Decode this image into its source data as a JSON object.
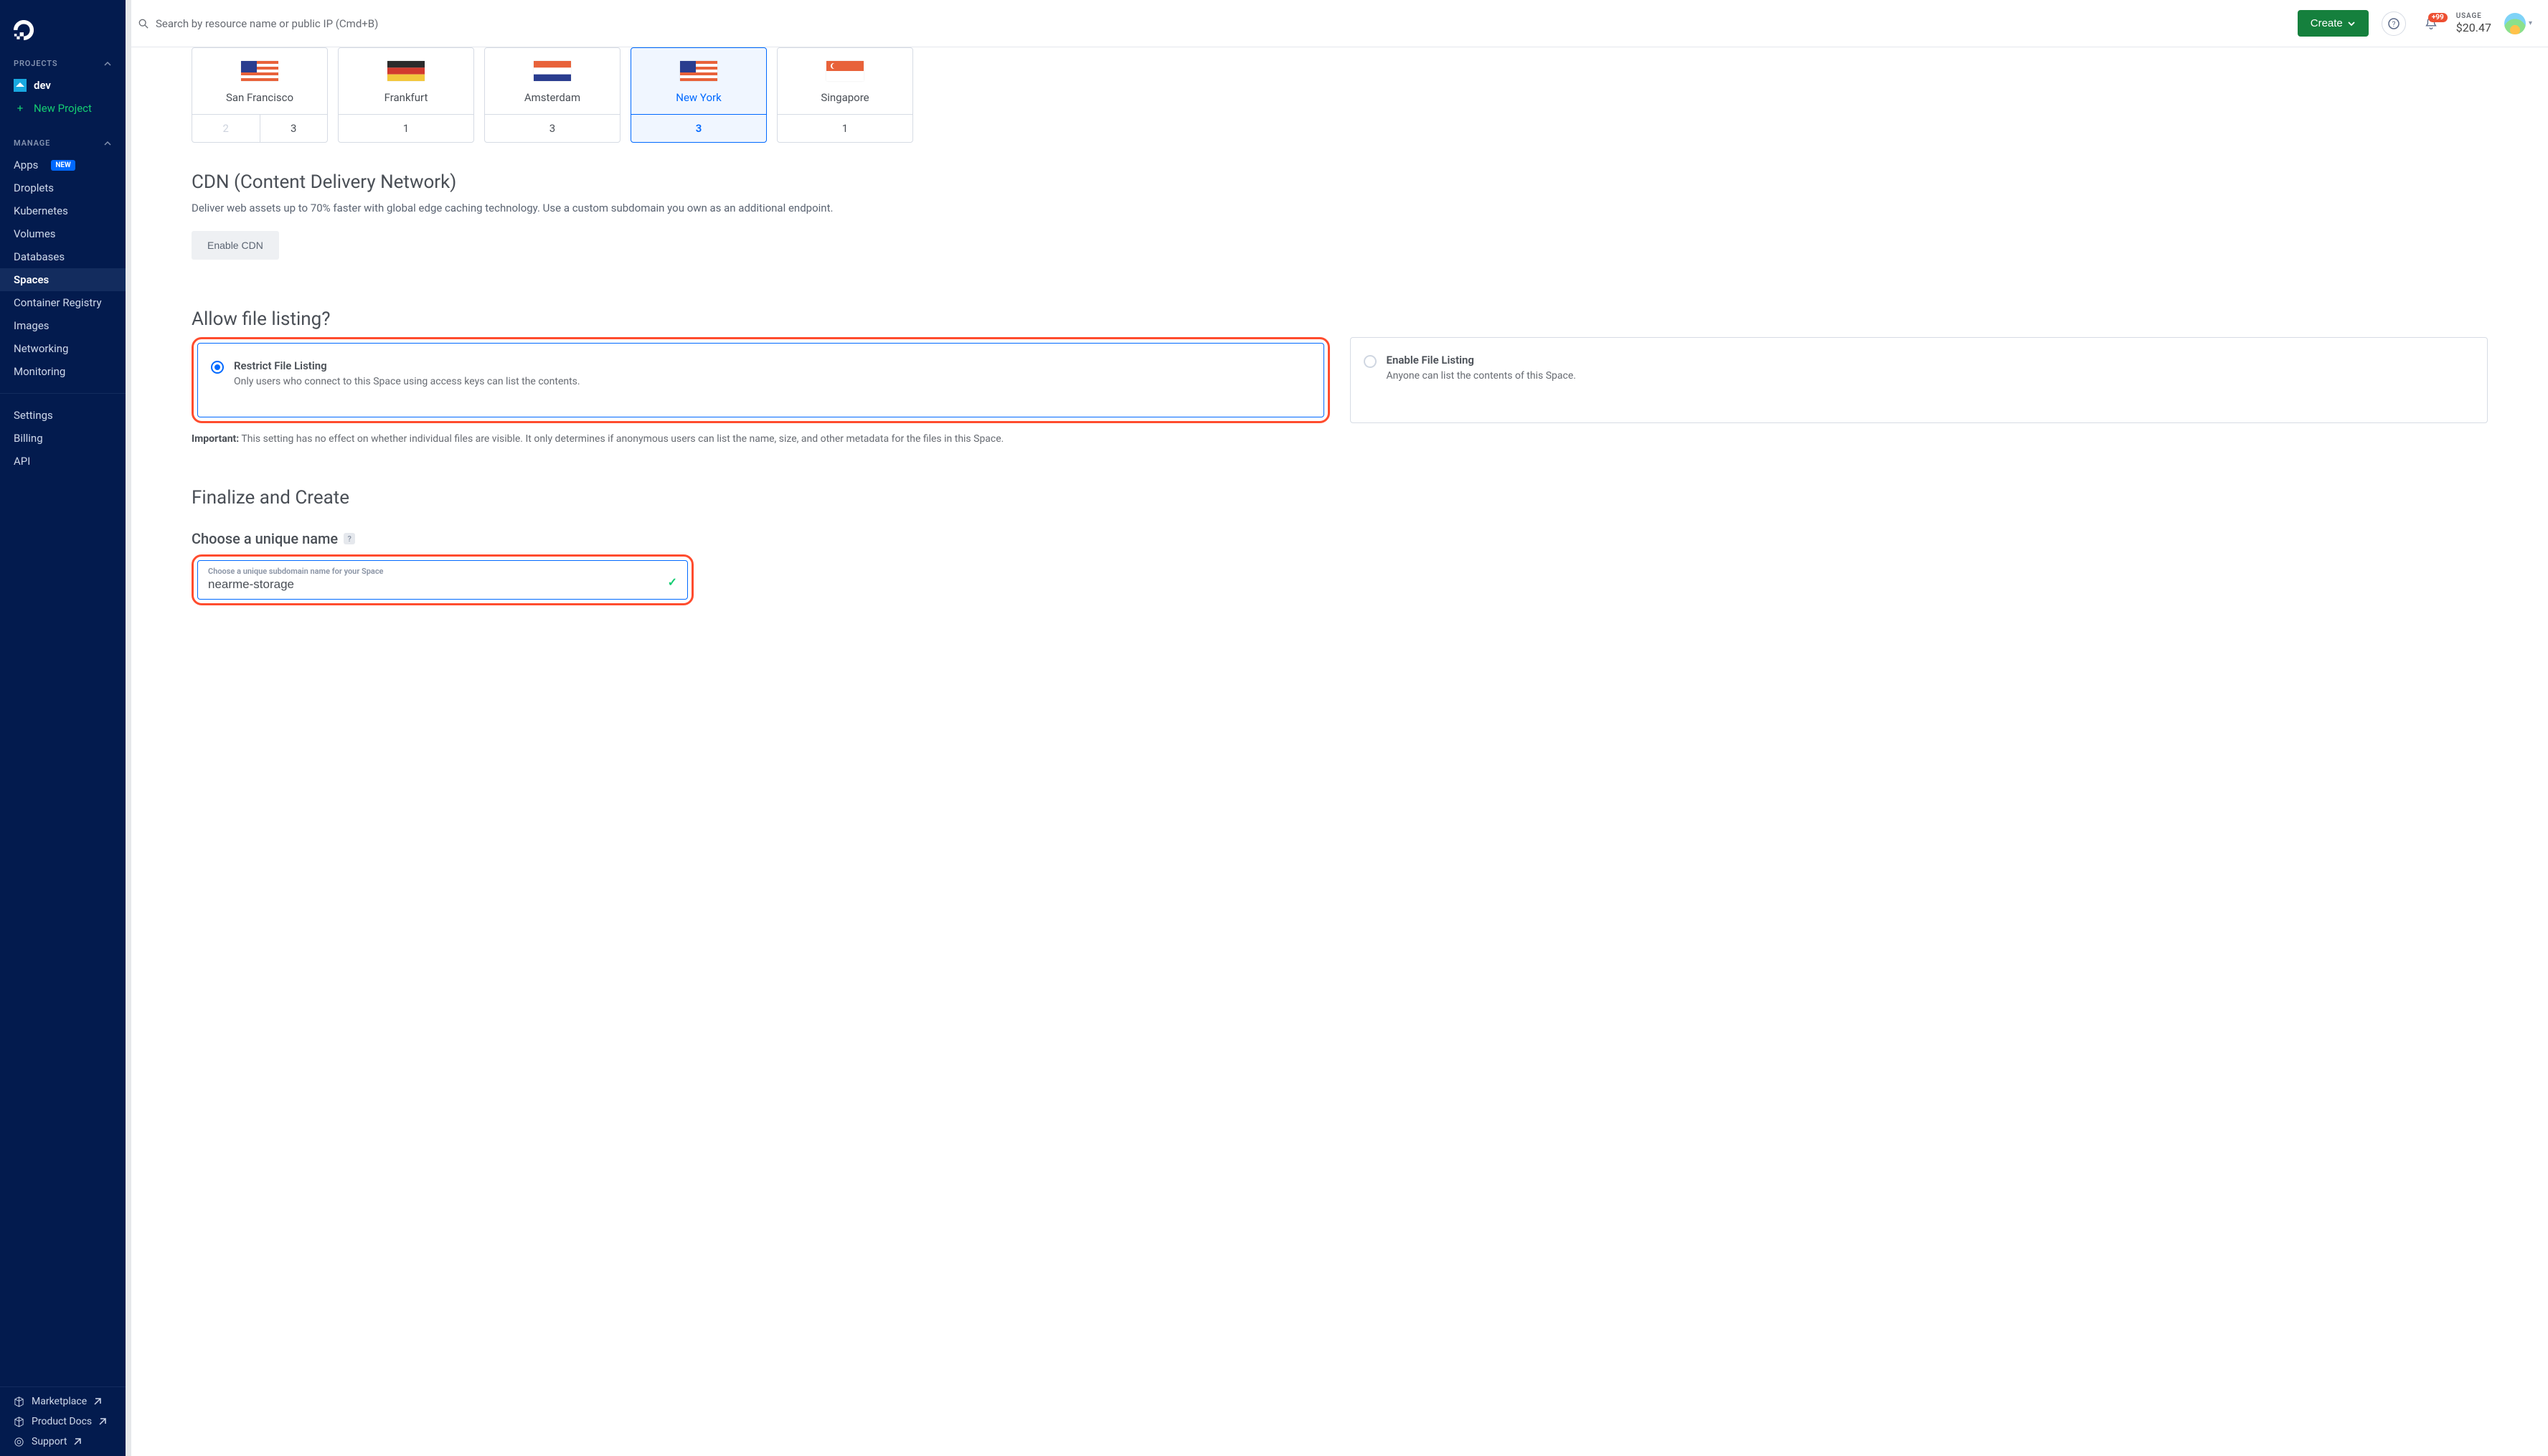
{
  "brand": "DigitalOcean",
  "sidebar": {
    "projects_label": "PROJECTS",
    "project_name": "dev",
    "new_project": "New Project",
    "manage_label": "MANAGE",
    "items": [
      {
        "label": "Apps",
        "badge": "NEW"
      },
      {
        "label": "Droplets"
      },
      {
        "label": "Kubernetes"
      },
      {
        "label": "Volumes"
      },
      {
        "label": "Databases"
      },
      {
        "label": "Spaces",
        "active": true
      },
      {
        "label": "Container Registry"
      },
      {
        "label": "Images"
      },
      {
        "label": "Networking"
      },
      {
        "label": "Monitoring"
      }
    ],
    "account": [
      {
        "label": "Settings"
      },
      {
        "label": "Billing"
      },
      {
        "label": "API"
      }
    ],
    "footer": [
      {
        "label": "Marketplace"
      },
      {
        "label": "Product Docs"
      },
      {
        "label": "Support"
      }
    ]
  },
  "topbar": {
    "search_placeholder": "Search by resource name or public IP (Cmd+B)",
    "create_label": "Create",
    "notification_count": "+99",
    "usage_label": "USAGE",
    "usage_value": "$20.47"
  },
  "regions": [
    {
      "name": "San Francisco",
      "flag": "us",
      "sub": [
        "2",
        "3"
      ],
      "selected": false
    },
    {
      "name": "Frankfurt",
      "flag": "de",
      "sub": [
        "1"
      ],
      "selected": false
    },
    {
      "name": "Amsterdam",
      "flag": "nl",
      "sub": [
        "3"
      ],
      "selected": false
    },
    {
      "name": "New York",
      "flag": "us",
      "sub": [
        "3"
      ],
      "selected": true
    },
    {
      "name": "Singapore",
      "flag": "sg",
      "sub": [
        "1"
      ],
      "selected": false
    }
  ],
  "cdn": {
    "title": "CDN (Content Delivery Network)",
    "desc": "Deliver web assets up to 70% faster with global edge caching technology. Use a custom subdomain you own as an additional endpoint.",
    "button": "Enable CDN"
  },
  "listing": {
    "title": "Allow file listing?",
    "option1_title": "Restrict File Listing",
    "option1_desc": "Only users who connect to this Space using access keys can list the contents.",
    "option2_title": "Enable File Listing",
    "option2_desc": "Anyone can list the contents of this Space.",
    "important_label": "Important:",
    "important_text": " This setting has no effect on whether individual files are visible. It only determines if anonymous users can list the name, size, and other metadata for the files in this Space."
  },
  "finalize": {
    "title": "Finalize and Create",
    "name_heading": "Choose a unique name",
    "name_label": "Choose a unique subdomain name for your Space",
    "name_value": "nearme-storage"
  }
}
